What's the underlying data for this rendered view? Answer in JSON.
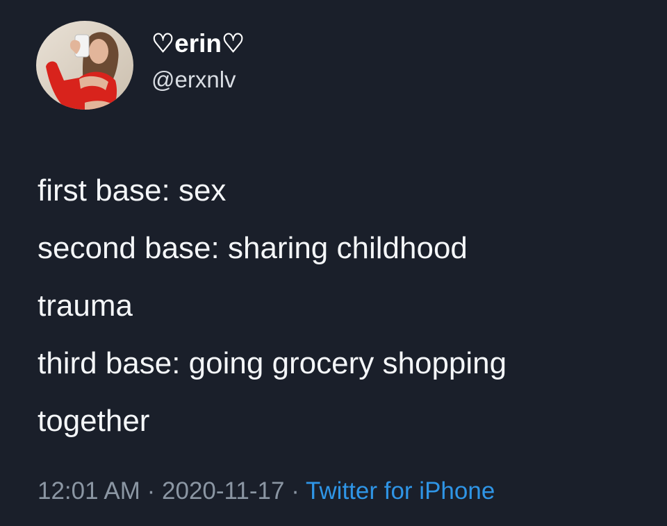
{
  "tweet": {
    "author": {
      "display_name": "♡erin♡",
      "handle": "@erxnlv"
    },
    "text_lines": [
      "first base: sex",
      "second base: sharing childhood",
      "trauma",
      "third base: going grocery shopping",
      "together"
    ],
    "meta": {
      "time": "12:01 AM",
      "separator": "·",
      "date": "2020-11-17",
      "source": "Twitter for iPhone"
    }
  },
  "colors": {
    "background": "#1a1f2a",
    "text": "#f4f6f8",
    "meta": "#8b96a3",
    "link": "#2f95e6"
  }
}
